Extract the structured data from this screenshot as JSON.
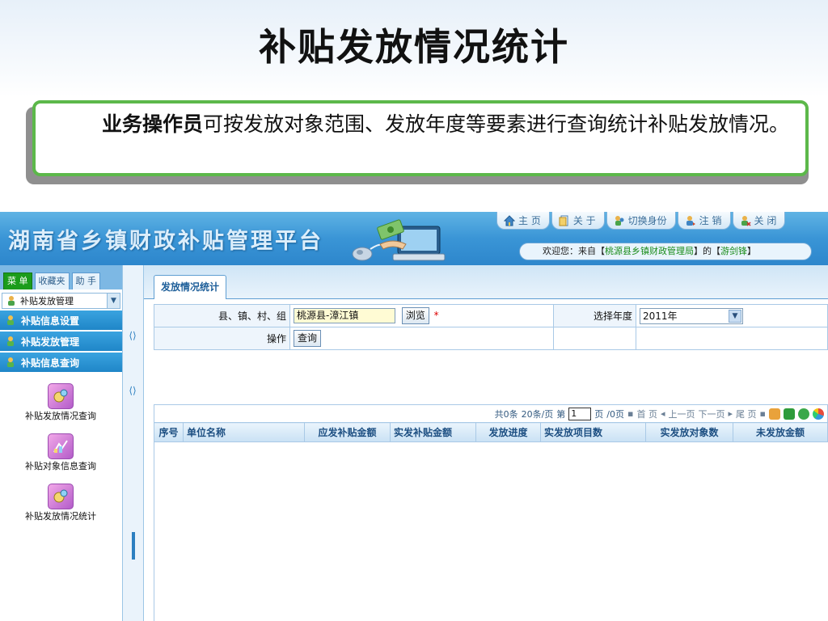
{
  "slide": {
    "title": "补贴发放情况统计",
    "desc_bold": "业务操作员",
    "desc_rest": "可按发放对象范围、发放年度等要素进行查询统计补贴发放情况。"
  },
  "header": {
    "brand": "湖南省乡镇财政补贴管理平台",
    "nav": [
      "主 页",
      "关 于",
      "切换身份",
      "注 销",
      "关 闭"
    ],
    "welcome_prefix": "欢迎您：来自【",
    "welcome_org": "桃源县乡镇财政管理局",
    "welcome_mid": "】的【",
    "welcome_user": "游剑锋",
    "welcome_suffix": "】"
  },
  "sidebar": {
    "tabs": [
      "菜 单",
      "收藏夹",
      "助 手"
    ],
    "active_tab": 0,
    "select_value": "补贴发放管理",
    "groups": [
      "补贴信息设置",
      "补贴发放管理",
      "补贴信息查询"
    ],
    "entries": [
      "补贴发放情况查询",
      "补贴对象信息查询",
      "补贴发放情况统计"
    ]
  },
  "main": {
    "tab_label": "发放情况统计",
    "form": {
      "region_label": "县、镇、村、组",
      "region_value": "桃源县-漳江镇",
      "browse_label": "浏览",
      "required_mark": "*",
      "year_label": "选择年度",
      "year_value": "2011年",
      "action_label": "操作",
      "query_label": "查询"
    },
    "pager": {
      "summary": "共0条",
      "per_page": "20条/页",
      "page_prefix": "第",
      "page_value": "1",
      "page_suffix": "页",
      "total_pages": "/0页",
      "first": "首 页",
      "prev": "上一页",
      "next": "下一页",
      "last": "尾 页"
    },
    "columns": [
      "序号",
      "单位名称",
      "应发补贴金额",
      "实发补贴金额",
      "发放进度",
      "实发放项目数",
      "实发放对象数",
      "未发放金额"
    ]
  },
  "colors": {
    "banner": "#3a95d6",
    "accent_green": "#5cb84a",
    "menu_active": "#1b9c1b",
    "required": "#dd0000"
  }
}
